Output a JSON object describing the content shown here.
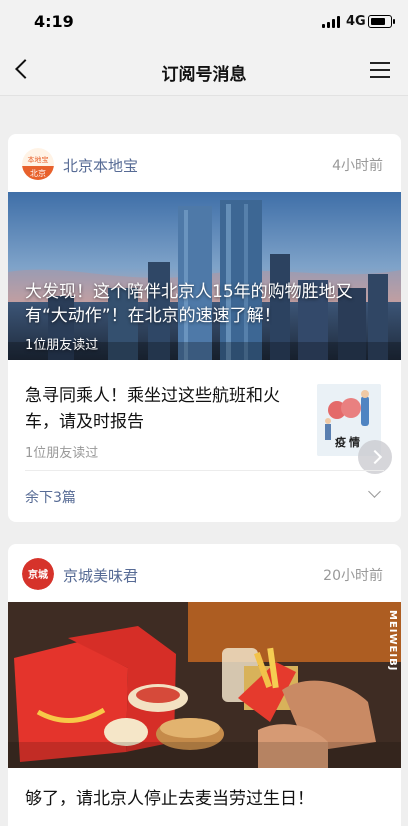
{
  "status": {
    "time": "4:19",
    "network": "4G",
    "battery_level": 0.8
  },
  "nav": {
    "title": "订阅号消息"
  },
  "cards": [
    {
      "account": "北京本地宝",
      "time": "4小时前",
      "avatar_text_top": "本地宝",
      "avatar_text_bottom": "北京",
      "hero_title": "大发现！这个陪伴北京人15年的购物胜地又有“大动作”！在北京的速速了解！",
      "hero_read": "1位朋友读过",
      "item2_title": "急寻同乘人！乘坐过这些航班和火车，请及时报告",
      "item2_read": "1位朋友读过",
      "thumb_label": "疫情",
      "more_label": "余下3篇"
    },
    {
      "account": "京城美味君",
      "time": "20小时前",
      "avatar_text": "京城",
      "hero_watermark": "MEIWEIBJ",
      "title": "够了，请北京人停止去麦当劳过生日！"
    }
  ],
  "colors": {
    "link_blue": "#576b95",
    "muted_gray": "#999999",
    "page_bg": "#efefef"
  }
}
